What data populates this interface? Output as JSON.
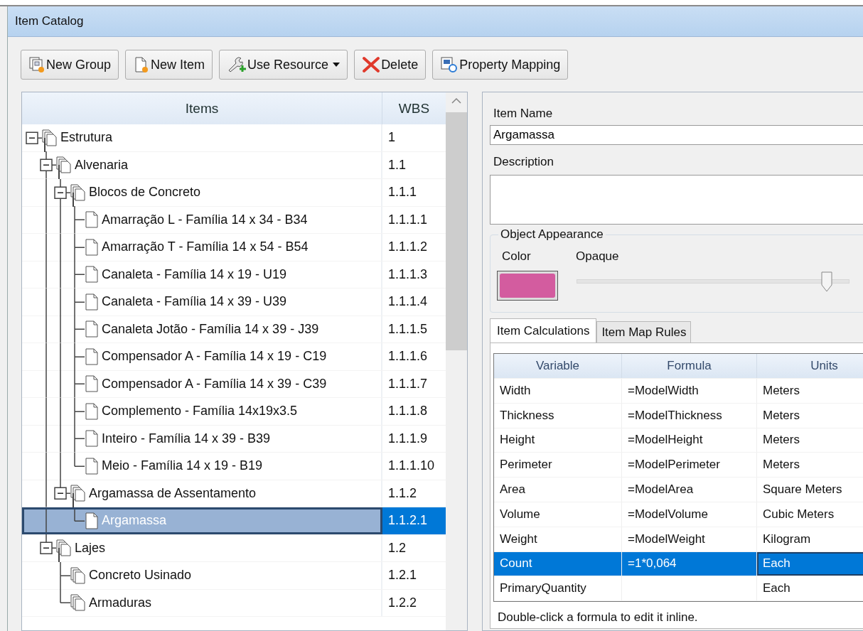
{
  "window": {
    "title": "Item Catalog"
  },
  "toolbar": [
    {
      "label": "New Group",
      "kind": "new-group",
      "dropdown": false
    },
    {
      "label": "New Item",
      "kind": "new-item",
      "dropdown": false
    },
    {
      "label": "Use Resource",
      "kind": "use-resource",
      "dropdown": true
    },
    {
      "label": "Delete",
      "kind": "delete",
      "dropdown": false
    },
    {
      "label": "Property Mapping",
      "kind": "property-mapping",
      "dropdown": false
    }
  ],
  "tree": {
    "columns": [
      "Items",
      "WBS"
    ],
    "items": [
      {
        "label": "Estrutura",
        "wbs": "1",
        "kind": "group",
        "expanded": true,
        "selected": false,
        "children": [
          {
            "label": "Alvenaria",
            "wbs": "1.1",
            "kind": "group",
            "expanded": true,
            "selected": false,
            "children": [
              {
                "label": "Blocos de Concreto",
                "wbs": "1.1.1",
                "kind": "group",
                "expanded": true,
                "selected": false,
                "children": [
                  {
                    "label": "Amarração L - Família 14 x 34 - B34",
                    "wbs": "1.1.1.1",
                    "kind": "item",
                    "selected": false
                  },
                  {
                    "label": "Amarração T - Família 14 x 54 - B54",
                    "wbs": "1.1.1.2",
                    "kind": "item",
                    "selected": false
                  },
                  {
                    "label": "Canaleta - Família 14 x 19 - U19",
                    "wbs": "1.1.1.3",
                    "kind": "item",
                    "selected": false
                  },
                  {
                    "label": "Canaleta - Família 14 x 39 - U39",
                    "wbs": "1.1.1.4",
                    "kind": "item",
                    "selected": false
                  },
                  {
                    "label": "Canaleta Jotão - Família 14 x 39 - J39",
                    "wbs": "1.1.1.5",
                    "kind": "item",
                    "selected": false
                  },
                  {
                    "label": "Compensador A - Família 14 x 19 - C19",
                    "wbs": "1.1.1.6",
                    "kind": "item",
                    "selected": false
                  },
                  {
                    "label": "Compensador A - Família 14 x 39 - C39",
                    "wbs": "1.1.1.7",
                    "kind": "item",
                    "selected": false
                  },
                  {
                    "label": "Complemento - Família 14x19x3.5",
                    "wbs": "1.1.1.8",
                    "kind": "item",
                    "selected": false
                  },
                  {
                    "label": "Inteiro - Família 14 x 39 - B39",
                    "wbs": "1.1.1.9",
                    "kind": "item",
                    "selected": false
                  },
                  {
                    "label": "Meio - Família 14 x 19 - B19",
                    "wbs": "1.1.1.10",
                    "kind": "item",
                    "selected": false
                  }
                ]
              },
              {
                "label": "Argamassa de Assentamento",
                "wbs": "1.1.2",
                "kind": "group",
                "expanded": true,
                "selected": false,
                "children": [
                  {
                    "label": "Argamassa",
                    "wbs": "1.1.2.1",
                    "kind": "item",
                    "selected": true
                  }
                ]
              }
            ]
          },
          {
            "label": "Lajes",
            "wbs": "1.2",
            "kind": "group",
            "expanded": true,
            "selected": false,
            "children": [
              {
                "label": "Concreto Usinado",
                "wbs": "1.2.1",
                "kind": "group",
                "selected": false
              },
              {
                "label": "Armaduras",
                "wbs": "1.2.2",
                "kind": "group",
                "selected": false
              }
            ]
          }
        ]
      }
    ]
  },
  "details": {
    "item_name_label": "Item Name",
    "item_name": "Argamassa",
    "description_label": "Description",
    "appearance": {
      "title": "Object Appearance",
      "color_label": "Color",
      "color": "#d35c9f",
      "opacity_label": "Opaque",
      "level": 0.88
    },
    "tabs": [
      {
        "label": "Item Calculations",
        "selected": true
      },
      {
        "label": "Item Map Rules",
        "selected": false
      }
    ],
    "grid": {
      "columns": [
        "Variable",
        "Formula",
        "Units"
      ],
      "rows": [
        {
          "variable": "Width",
          "formula": "=ModelWidth",
          "units": "Meters",
          "selected": false
        },
        {
          "variable": "Thickness",
          "formula": "=ModelThickness",
          "units": "Meters",
          "selected": false
        },
        {
          "variable": "Height",
          "formula": "=ModelHeight",
          "units": "Meters",
          "selected": false
        },
        {
          "variable": "Perimeter",
          "formula": "=ModelPerimeter",
          "units": "Meters",
          "selected": false
        },
        {
          "variable": "Area",
          "formula": "=ModelArea",
          "units": "Square Meters",
          "selected": false
        },
        {
          "variable": "Volume",
          "formula": "=ModelVolume",
          "units": "Cubic Meters",
          "selected": false
        },
        {
          "variable": "Weight",
          "formula": "=ModelWeight",
          "units": "Kilogram",
          "selected": false
        },
        {
          "variable": "Count",
          "formula": "=1*0,064",
          "units": "Each",
          "selected": true
        },
        {
          "variable": "PrimaryQuantity",
          "units": "Each",
          "selected": false
        }
      ]
    },
    "hint": "Double-click a formula to edit it inline."
  }
}
